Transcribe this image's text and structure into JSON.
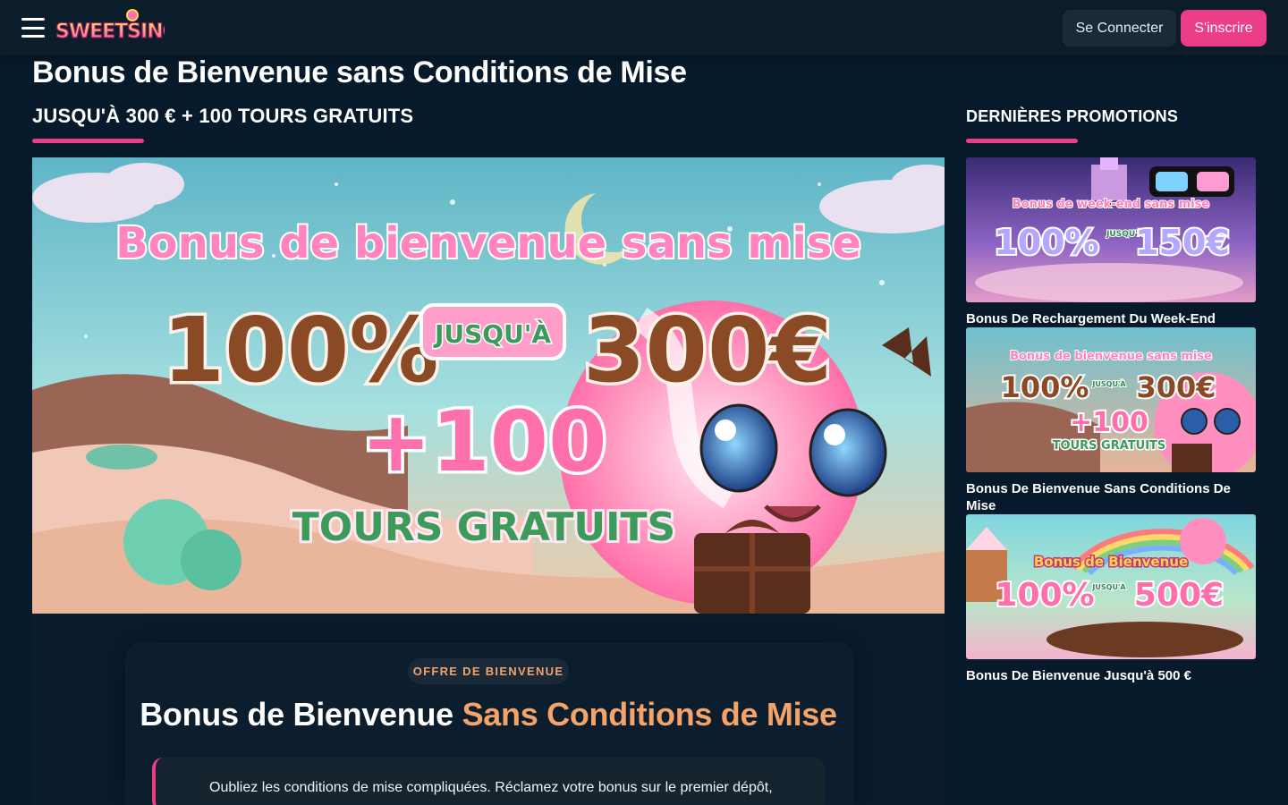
{
  "header": {
    "logo_text": "SWEETSINO",
    "login_label": "Se Connecter",
    "signup_label": "S'inscrire"
  },
  "main": {
    "title": "Bonus de Bienvenue sans Conditions de Mise",
    "subtitle": "JUSQU'À 300 € + 100 TOURS GRATUITS",
    "hero": {
      "headline": "Bonus de bienvenue sans mise",
      "percent": "100%",
      "up_to": "JUSQU'À",
      "amount": "300€",
      "spins": "+100",
      "spins_label": "TOURS GRATUITS"
    },
    "badge": "OFFRE DE BIENVENUE",
    "section_title_plain": "Bonus de Bienvenue ",
    "section_title_highlight": "Sans Conditions de Mise",
    "intro_text": "Oubliez les conditions de mise compliquées. Réclamez votre bonus sur le premier dépôt,"
  },
  "sidebar": {
    "heading": "DERNIÈRES PROMOTIONS",
    "promos": [
      {
        "label": "Bonus De Rechargement Du Week-End",
        "banner_top": "Bonus de week-end sans mise",
        "banner_percent": "100%",
        "banner_up_to": "JUSQU'À",
        "banner_amount": "150€"
      },
      {
        "label": "Bonus De Bienvenue Sans Conditions De Mise",
        "banner_top": "Bonus de bienvenue sans mise",
        "banner_percent": "100%",
        "banner_up_to": "JUSQU'À",
        "banner_amount": "300€",
        "banner_spins": "+100",
        "banner_spins_label": "TOURS GRATUITS"
      },
      {
        "label": "Bonus De Bienvenue Jusqu'à 500 €",
        "banner_top": "Bonus de Bienvenue",
        "banner_percent": "100%",
        "banner_up_to": "JUSQU'À",
        "banner_amount": "500€"
      }
    ]
  },
  "colors": {
    "background": "#071a2b",
    "accent_pink": "#ec3d88",
    "accent_orange": "#f4a468"
  }
}
